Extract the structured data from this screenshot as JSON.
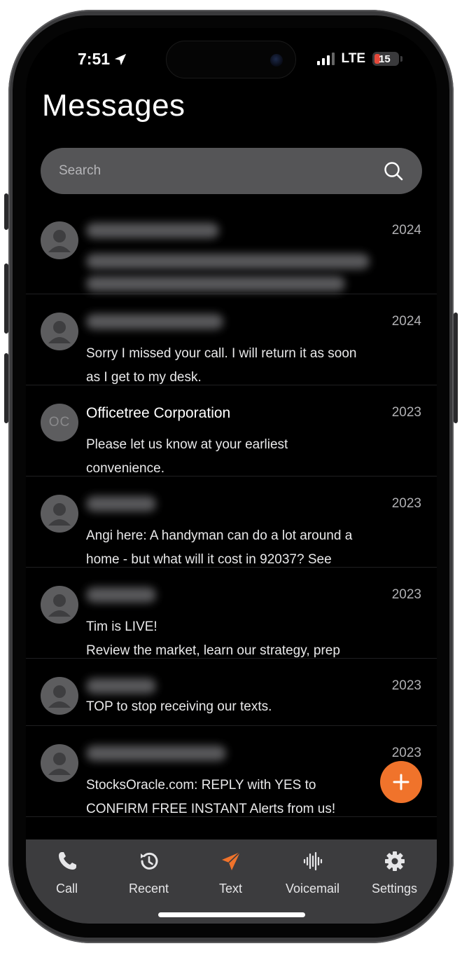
{
  "status_bar": {
    "time": "7:51",
    "network": "LTE",
    "battery": "15"
  },
  "header": {
    "title": "Messages"
  },
  "search": {
    "placeholder": "Search"
  },
  "colors": {
    "accent": "#f0732b",
    "tab_bar_bg": "#3c3c3e",
    "search_bg": "#555557"
  },
  "messages": [
    {
      "name": "",
      "date": "2024",
      "preview_line1": "",
      "preview_line2": "",
      "avatar": "person-icon"
    },
    {
      "name": "",
      "date": "2024",
      "preview_line1": "Sorry I missed your call. I will return it as soon",
      "preview_line2": "as I get to my desk.",
      "avatar": "person-icon"
    },
    {
      "name": "Officetree Corporation",
      "date": "2023",
      "preview_line1": "Please let us know at your earliest",
      "preview_line2": "convenience.",
      "avatar_initials": "OC"
    },
    {
      "name": "",
      "date": "2023",
      "preview_line1": "Angi here: A handyman can do a lot around a",
      "preview_line2": "home - but what will it cost in 92037? See",
      "avatar": "person-icon"
    },
    {
      "name": "",
      "date": "2023",
      "preview_line1": "Tim is LIVE!",
      "preview_line2": "Review the market, learn our strategy, prep",
      "avatar": "person-icon"
    },
    {
      "name": "",
      "date": "2023",
      "preview_line1": "TOP to stop receiving our texts.",
      "preview_line2": "",
      "avatar": "person-icon"
    },
    {
      "name": "",
      "date": "2023",
      "preview_line1": "StocksOracle.com: REPLY with YES to",
      "preview_line2": "CONFIRM FREE INSTANT Alerts from us!",
      "avatar": "person-icon"
    }
  ],
  "tabs": [
    {
      "label": "Call",
      "icon": "phone-icon",
      "active": false
    },
    {
      "label": "Recent",
      "icon": "history-icon",
      "active": false
    },
    {
      "label": "Text",
      "icon": "send-icon",
      "active": true
    },
    {
      "label": "Voicemail",
      "icon": "waveform-icon",
      "active": false
    },
    {
      "label": "Settings",
      "icon": "gear-icon",
      "active": false
    }
  ]
}
